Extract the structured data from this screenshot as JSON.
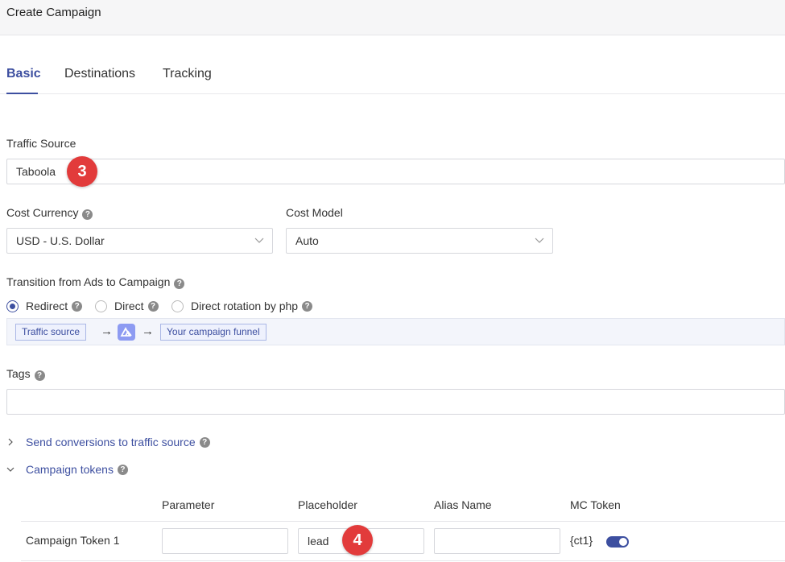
{
  "header": {
    "title": "Create Campaign"
  },
  "tabs": [
    {
      "label": "Basic",
      "active": true
    },
    {
      "label": "Destinations",
      "active": false
    },
    {
      "label": "Tracking",
      "active": false
    }
  ],
  "traffic_source": {
    "label": "Traffic Source",
    "value": "Taboola",
    "badge": "3"
  },
  "cost_currency": {
    "label": "Cost Currency",
    "value": "USD - U.S. Dollar"
  },
  "cost_model": {
    "label": "Cost Model",
    "value": "Auto"
  },
  "transition": {
    "label": "Transition from Ads to Campaign",
    "options": [
      {
        "label": "Redirect",
        "selected": true
      },
      {
        "label": "Direct",
        "selected": false
      },
      {
        "label": "Direct rotation by php",
        "selected": false
      }
    ],
    "flow": {
      "from": "Traffic source",
      "to": "Your campaign funnel",
      "arrow": "→"
    }
  },
  "tags": {
    "label": "Tags",
    "value": ""
  },
  "sections": {
    "send_conversions": "Send conversions to traffic source",
    "campaign_tokens": "Campaign tokens"
  },
  "tokens_table": {
    "headers": [
      "Parameter",
      "Placeholder",
      "Alias Name",
      "MC Token"
    ],
    "rows": [
      {
        "name": "Campaign Token 1",
        "parameter": "",
        "placeholder": "lead",
        "alias": "",
        "mc_token": "{ct1}",
        "enabled": true,
        "badge": "4"
      }
    ]
  },
  "colors": {
    "accent": "#3d4fa0",
    "badge": "#e23b3b",
    "chip_bg": "#eef1fd"
  },
  "help_glyph": "?"
}
